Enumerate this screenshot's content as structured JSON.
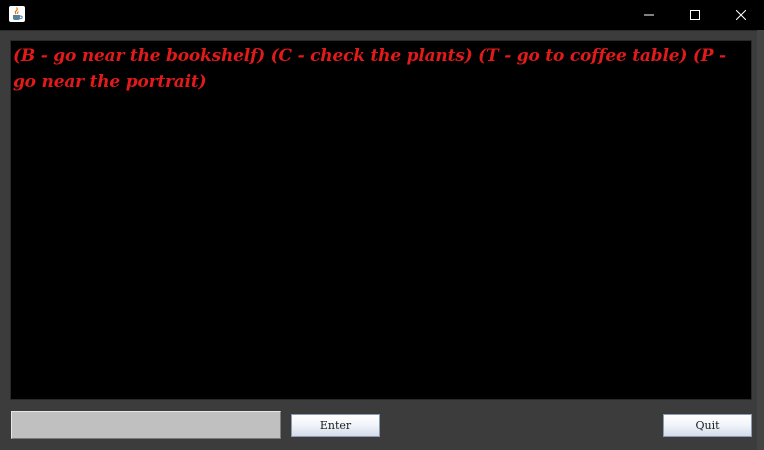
{
  "window": {
    "title": "",
    "icon": "java-cup-icon",
    "controls": {
      "minimize_icon": "minimize-icon",
      "maximize_icon": "maximize-icon",
      "close_icon": "close-icon"
    }
  },
  "game": {
    "output_text": "(B - go near the bookshelf) (C - check the plants) (T - go to coffee table) (P - go near the portrait)"
  },
  "controls": {
    "command_input_value": "",
    "enter_label": "Enter",
    "quit_label": "Quit"
  },
  "colors": {
    "background": "#3c3c3c",
    "output_background": "#000000",
    "output_text": "#e21a1a",
    "input_background": "#c0c0c0"
  }
}
